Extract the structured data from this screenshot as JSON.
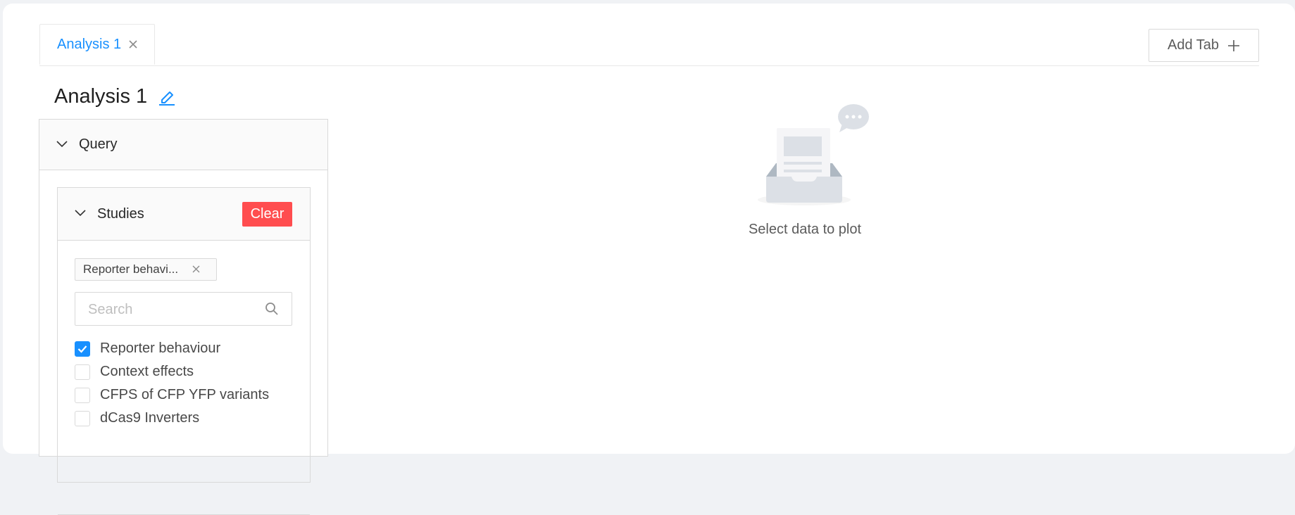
{
  "tabs": [
    {
      "label": "Analysis 1",
      "active": true
    }
  ],
  "add_tab_label": "Add Tab",
  "page_title": "Analysis 1",
  "query": {
    "header_label": "Query",
    "studies": {
      "header_label": "Studies",
      "clear_label": "Clear",
      "selected_tag": "Reporter behavi...",
      "search_placeholder": "Search",
      "search_value": "",
      "items": [
        {
          "label": "Reporter behaviour",
          "checked": true
        },
        {
          "label": "Context effects",
          "checked": false
        },
        {
          "label": "CFPS of CFP YFP variants",
          "checked": false
        },
        {
          "label": "dCas9 Inverters",
          "checked": false
        }
      ]
    }
  },
  "empty_state": {
    "text": "Select data to plot"
  },
  "colors": {
    "primary": "#1890ff",
    "danger": "#ff4d4f",
    "border": "#d9d9d9",
    "header_bg": "#fafafa"
  }
}
